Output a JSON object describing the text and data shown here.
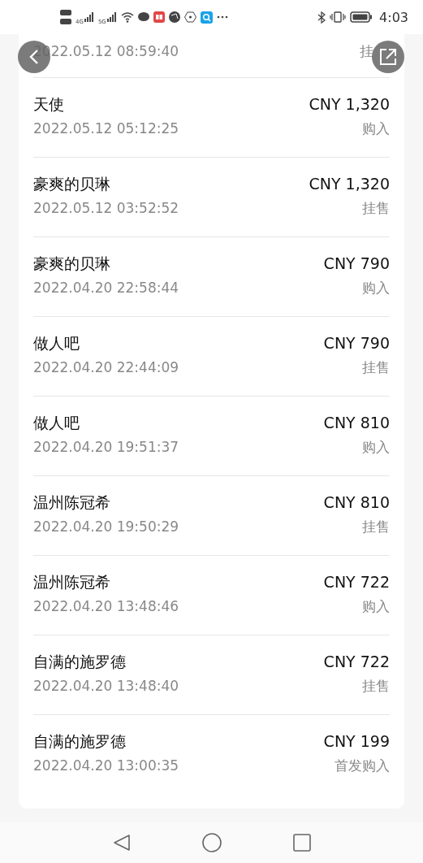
{
  "status_bar": {
    "network_1": "4G",
    "network_2": "5G",
    "time": "4:03"
  },
  "records": [
    {
      "time": "2022.05.12 08:59:40",
      "type": "挂"
    },
    {
      "name": "天使",
      "time": "2022.05.12 05:12:25",
      "price": "CNY 1,320",
      "type": "购入"
    },
    {
      "name": "豪爽的贝琳",
      "time": "2022.05.12 03:52:52",
      "price": "CNY 1,320",
      "type": "挂售"
    },
    {
      "name": "豪爽的贝琳",
      "time": "2022.04.20 22:58:44",
      "price": "CNY 790",
      "type": "购入"
    },
    {
      "name": "做人吧",
      "time": "2022.04.20 22:44:09",
      "price": "CNY 790",
      "type": "挂售"
    },
    {
      "name": "做人吧",
      "time": "2022.04.20 19:51:37",
      "price": "CNY 810",
      "type": "购入"
    },
    {
      "name": "温州陈冠希",
      "time": "2022.04.20 19:50:29",
      "price": "CNY 810",
      "type": "挂售"
    },
    {
      "name": "温州陈冠希",
      "time": "2022.04.20 13:48:46",
      "price": "CNY 722",
      "type": "购入"
    },
    {
      "name": "自满的施罗德",
      "time": "2022.04.20 13:48:40",
      "price": "CNY 722",
      "type": "挂售"
    },
    {
      "name": "自满的施罗德",
      "time": "2022.04.20 13:00:35",
      "price": "CNY 199",
      "type": "首发购入"
    }
  ]
}
